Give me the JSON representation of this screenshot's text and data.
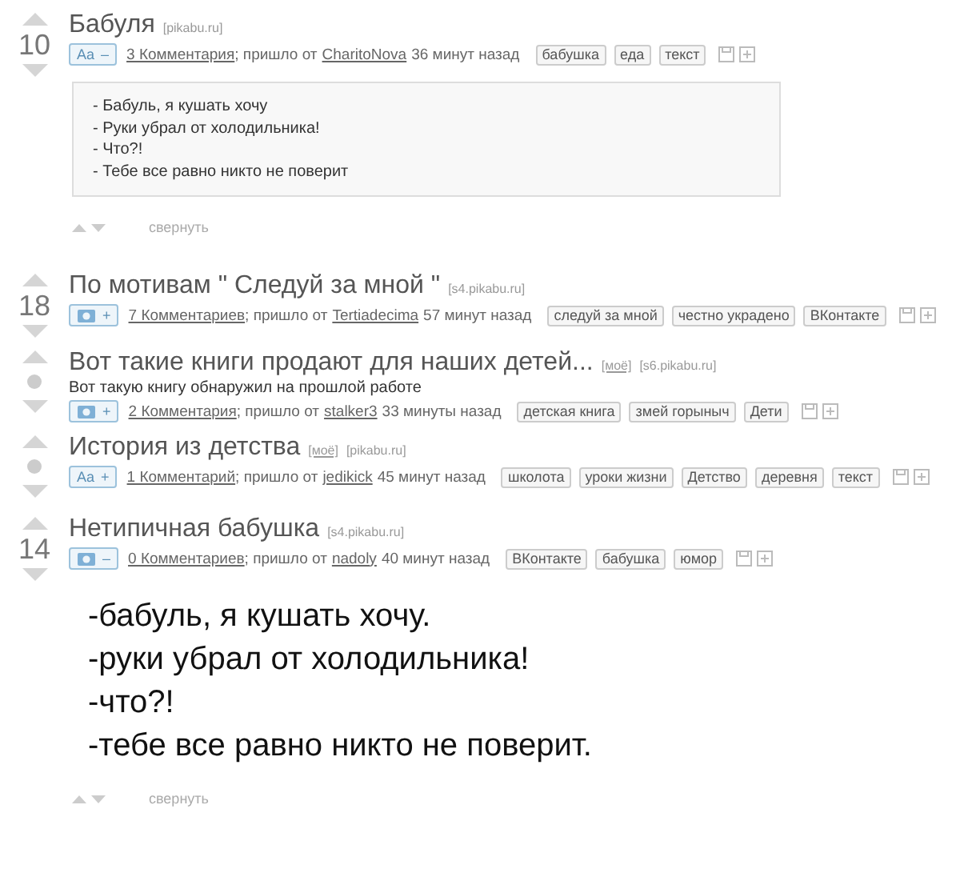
{
  "posts": [
    {
      "rating": "10",
      "title": "Бабуля",
      "domain": "[pikabu.ru]",
      "badge": {
        "kind": "text",
        "icon_text": "Aa",
        "sign": "–"
      },
      "comments": "3 Комментария",
      "from_label": "; пришло от",
      "author": "CharitoNova",
      "time": "36 минут назад",
      "tags": [
        "бабушка",
        "еда",
        "текст"
      ],
      "content": {
        "kind": "text_box",
        "lines": [
          "- Бабуль, я кушать хочу",
          "- Руки убрал от холодильника!",
          "- Что?!",
          "- Тебе все равно никто не поверит"
        ]
      },
      "collapse_label": "свернуть"
    },
    {
      "rating": "18",
      "title": "По мотивам \" Следуй за мной \"",
      "domain": "[s4.pikabu.ru]",
      "badge": {
        "kind": "image",
        "sign": "+"
      },
      "comments": "7 Комментариев",
      "from_label": "; пришло от",
      "author": "Tertiadecima",
      "time": "57 минут назад",
      "tags": [
        "следуй за мной",
        "честно украдено",
        "ВКонтакте"
      ]
    },
    {
      "title": "Вот такие книги продают для наших детей...",
      "mine": "[моё]",
      "domain": "[s6.pikabu.ru]",
      "description": "Вот такую книгу обнаружил на прошлой работе",
      "badge": {
        "kind": "image",
        "sign": "+"
      },
      "comments": "2 Комментария",
      "from_label": "; пришло от",
      "author": "stalker3",
      "time": "33 минуты назад",
      "tags": [
        "детская книга",
        "змей горыныч",
        "Дети"
      ]
    },
    {
      "title": "История из детства",
      "mine": "[моё]",
      "domain": "[pikabu.ru]",
      "badge": {
        "kind": "text",
        "icon_text": "Aa",
        "sign": "+"
      },
      "comments": "1 Комментарий",
      "from_label": "; пришло от",
      "author": "jedikick",
      "time": "45 минут назад",
      "tags": [
        "школота",
        "уроки жизни",
        "Детство",
        "деревня",
        "текст"
      ]
    },
    {
      "rating": "14",
      "title": "Нетипичная бабушка",
      "domain": "[s4.pikabu.ru]",
      "badge": {
        "kind": "image",
        "sign": "–"
      },
      "comments": "0 Комментариев",
      "from_label": "; пришло от",
      "author": "nadoly",
      "time": "40 минут назад",
      "tags": [
        "ВКонтакте",
        "бабушка",
        "юмор"
      ],
      "content": {
        "kind": "text_image",
        "lines": [
          "-бабуль, я кушать хочу.",
          "-руки убрал от холодильника!",
          "-что?!",
          "-тебе все равно никто не поверит."
        ]
      },
      "collapse_label": "свернуть"
    }
  ]
}
